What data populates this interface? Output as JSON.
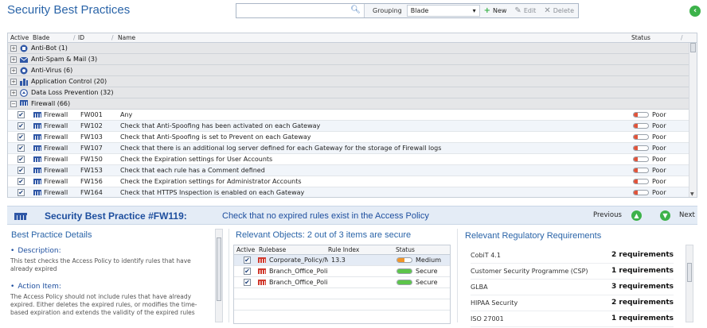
{
  "header": {
    "title": "Security Best Practices",
    "search_placeholder": "",
    "grouping_label": "Grouping",
    "grouping_value": "Blade",
    "new_label": "New",
    "edit_label": "Edit",
    "delete_label": "Delete"
  },
  "grid": {
    "columns": {
      "active": "Active",
      "blade": "Blade",
      "id": "ID",
      "name": "Name",
      "status": "Status"
    },
    "groups": [
      {
        "label": "Anti-Bot  (1)",
        "icon": "anti-bot-icon"
      },
      {
        "label": "Anti-Spam & Mail  (3)",
        "icon": "mail-icon"
      },
      {
        "label": "Anti-Virus  (6)",
        "icon": "anti-virus-icon"
      },
      {
        "label": "Application Control  (20)",
        "icon": "app-control-icon"
      },
      {
        "label": "Data Loss Prevention  (32)",
        "icon": "dlp-icon"
      },
      {
        "label": "Firewall  (66)",
        "icon": "firewall-icon"
      }
    ],
    "rows": [
      {
        "blade": "Firewall",
        "id": "FW001",
        "name": "Any",
        "status": "Poor"
      },
      {
        "blade": "Firewall",
        "id": "FW102",
        "name": "Check that Anti-Spoofing has been activated on each Gateway",
        "status": "Poor"
      },
      {
        "blade": "Firewall",
        "id": "FW103",
        "name": "Check that Anti-Spoofing is set to Prevent on each Gateway",
        "status": "Poor"
      },
      {
        "blade": "Firewall",
        "id": "FW107",
        "name": "Check that there is an additional log server defined for each Gateway for the storage of Firewall logs",
        "status": "Poor"
      },
      {
        "blade": "Firewall",
        "id": "FW150",
        "name": "Check the Expiration settings for User Accounts",
        "status": "Poor"
      },
      {
        "blade": "Firewall",
        "id": "FW153",
        "name": "Check that each rule has a Comment defined",
        "status": "Poor"
      },
      {
        "blade": "Firewall",
        "id": "FW156",
        "name": "Check the Expiration settings for Administrator Accounts",
        "status": "Poor"
      },
      {
        "blade": "Firewall",
        "id": "FW164",
        "name": "Check that HTTPS Inspection is enabled on each Gateway",
        "status": "Poor"
      }
    ]
  },
  "detail": {
    "title": "Security Best Practice #FW119:",
    "subtitle": "Check that no expired rules exist in the Access Policy",
    "previous_label": "Previous",
    "next_label": "Next",
    "bp_title": "Best Practice Details",
    "description_heading": "Description:",
    "description_text": "This test checks the Access Policy to identify rules that have already expired",
    "action_heading": "Action Item:",
    "action_text": "The Access Policy should not include rules that have already expired. Either deletes the expired rules, or modifies the time-based expiration and extends the validity of the expired rules",
    "objects_title": "Relevant Objects: 2 out of 3 items are secure",
    "objects_columns": {
      "active": "Active",
      "rulebase": "Rulebase",
      "rule_index": "Rule Index",
      "status": "Status"
    },
    "objects": [
      {
        "rulebase": "Corporate_Policy/Net",
        "rule_index": "13.3",
        "status": "Medium",
        "color": "#f0962a",
        "fill": 0.5
      },
      {
        "rulebase": "Branch_Office_Policy",
        "rule_index": "",
        "status": "Secure",
        "color": "#5cc44a",
        "fill": 1.0
      },
      {
        "rulebase": "Branch_Office_Policy",
        "rule_index": "",
        "status": "Secure",
        "color": "#5cc44a",
        "fill": 1.0
      }
    ],
    "reg_title": "Relevant Regulatory Requirements",
    "regulations": [
      {
        "name": "CobiT 4.1",
        "count": "2 requirements"
      },
      {
        "name": "Customer Security Programme (CSP)",
        "count": "1 requirements"
      },
      {
        "name": "GLBA",
        "count": "3 requirements"
      },
      {
        "name": "HIPAA Security",
        "count": "2 requirements"
      },
      {
        "name": "ISO 27001",
        "count": "1 requirements"
      }
    ]
  },
  "colors": {
    "accent": "#2a64a8",
    "poor": "#e0533a",
    "medium": "#f0962a",
    "secure": "#5cc44a",
    "go_green": "#3cb24a"
  }
}
